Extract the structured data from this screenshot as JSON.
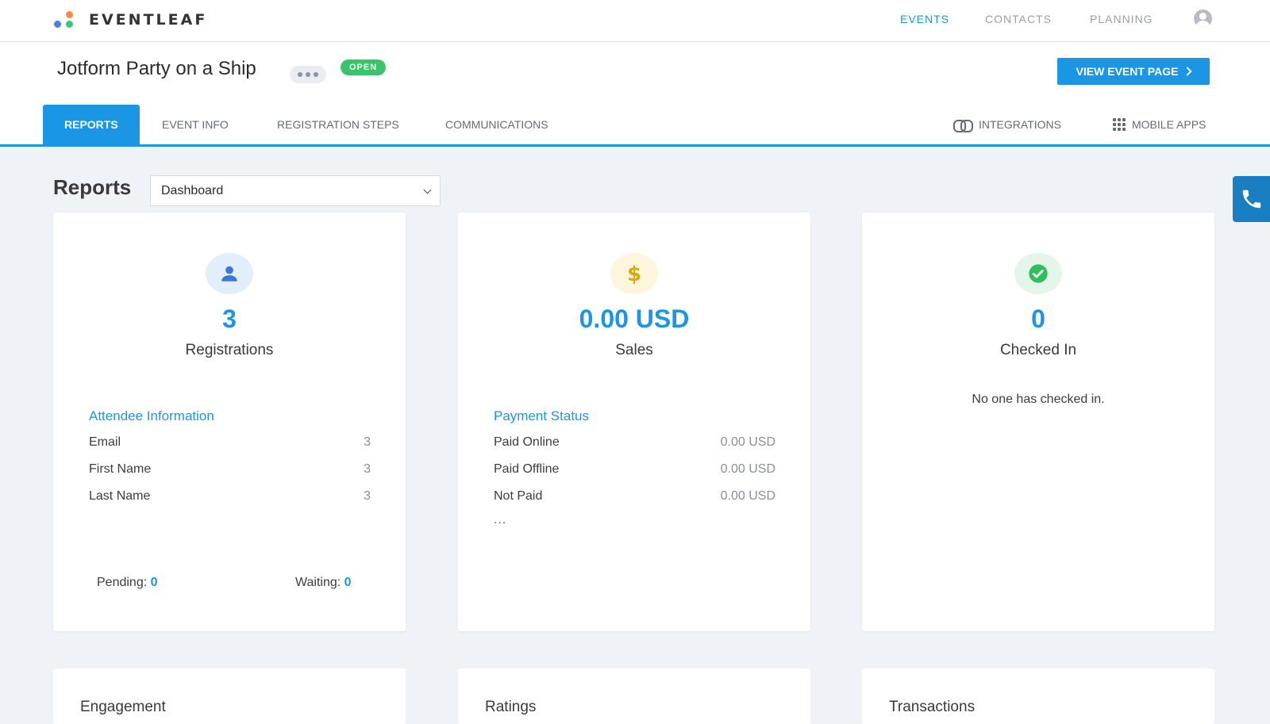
{
  "app": {
    "brand": "EVENTLEAF"
  },
  "topnav": {
    "events": "EVENTS",
    "contacts": "CONTACTS",
    "planning": "PLANNING"
  },
  "event": {
    "title": "Jotform Party on a Ship",
    "status": "OPEN",
    "view_button": "VIEW EVENT PAGE"
  },
  "tabs": {
    "reports": "REPORTS",
    "event_info": "EVENT INFO",
    "registration_steps": "REGISTRATION STEPS",
    "communications": "COMMUNICATIONS",
    "integrations": "INTEGRATIONS",
    "mobile_apps": "MOBILE APPS"
  },
  "reports": {
    "title": "Reports",
    "select_value": "Dashboard"
  },
  "cards": {
    "registrations": {
      "icon": "person-icon",
      "value": "3",
      "label": "Registrations",
      "section": "Attendee Information",
      "rows": [
        {
          "label": "Email",
          "value": "3"
        },
        {
          "label": "First Name",
          "value": "3"
        },
        {
          "label": "Last Name",
          "value": "3"
        }
      ],
      "pending_label": "Pending:",
      "pending_value": "0",
      "waiting_label": "Waiting:",
      "waiting_value": "0"
    },
    "sales": {
      "icon": "dollar-icon",
      "value": "0.00 USD",
      "label": "Sales",
      "section": "Payment Status",
      "rows": [
        {
          "label": "Paid Online",
          "value": "0.00 USD"
        },
        {
          "label": "Paid Offline",
          "value": "0.00 USD"
        },
        {
          "label": "Not Paid",
          "value": "0.00 USD"
        }
      ],
      "more": "..."
    },
    "checked_in": {
      "icon": "check-circle-icon",
      "value": "0",
      "label": "Checked In",
      "message": "No one has checked in."
    }
  },
  "lower_cards": {
    "engagement": "Engagement",
    "ratings": "Ratings",
    "transactions": "Transactions"
  },
  "colors": {
    "accent": "#1a96e5",
    "status_open": "#39c46b",
    "background": "#eff2f7"
  }
}
